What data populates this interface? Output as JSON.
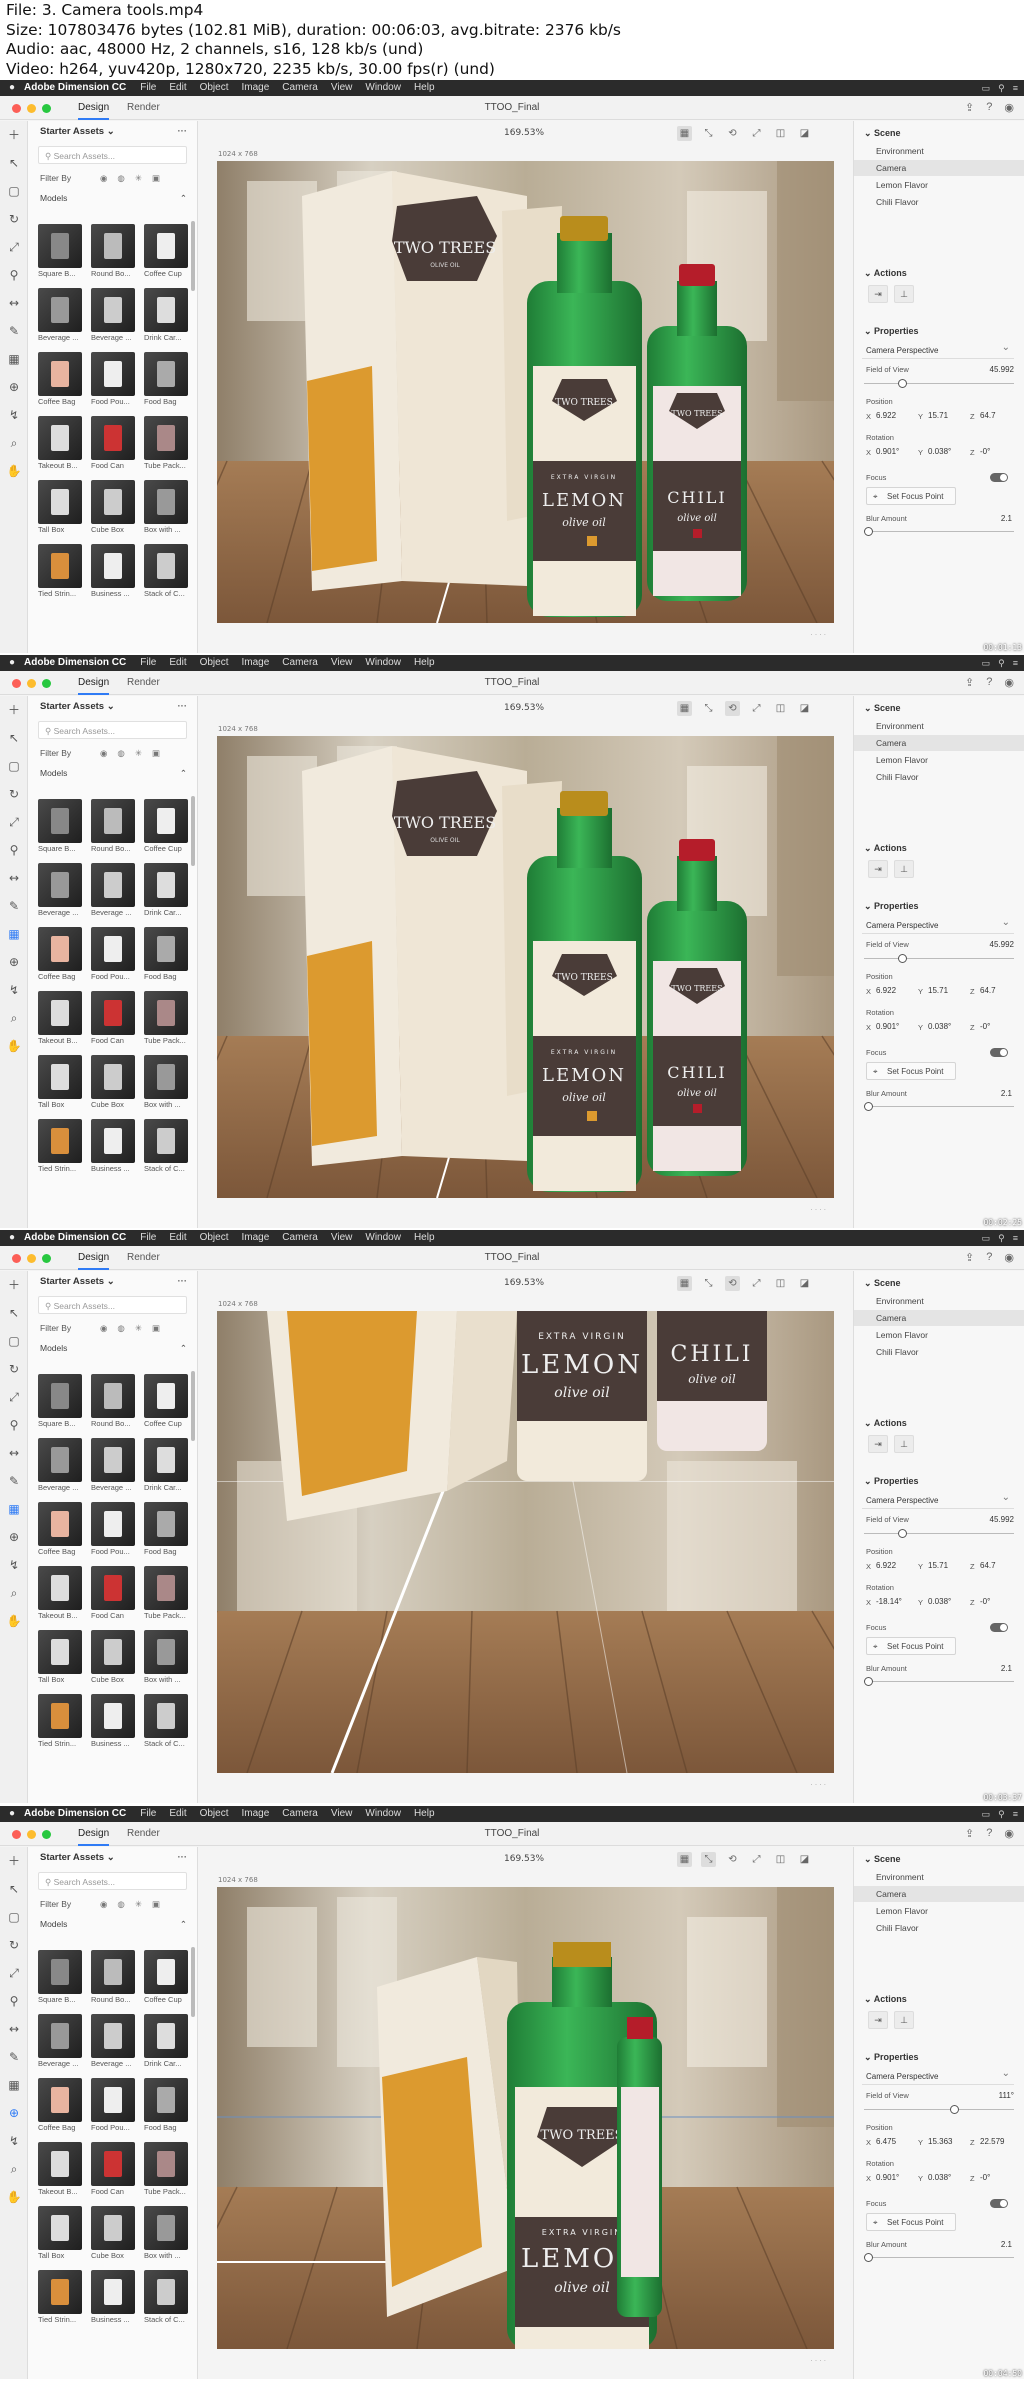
{
  "info_lines": [
    "File: 3. Camera tools.mp4",
    "Size: 107803476 bytes (102.81 MiB), duration: 00:06:03, avg.bitrate: 2376 kb/s",
    "Audio: aac, 48000 Hz, 2 channels, s16, 128 kb/s (und)",
    "Video: h264, yuv420p, 1280x720, 2235 kb/s, 30.00 fps(r) (und)"
  ],
  "menubar": {
    "app": "Adobe Dimension CC",
    "items": [
      "File",
      "Edit",
      "Object",
      "Image",
      "Camera",
      "View",
      "Window",
      "Help"
    ]
  },
  "tabs": {
    "design": "Design",
    "render": "Render"
  },
  "doc_title": "TTOO_Final",
  "assets": {
    "header": "Starter Assets",
    "search_placeholder": "Search Assets...",
    "filter_label": "Filter By",
    "models_label": "Models",
    "items": [
      "Square B...",
      "Round Bo...",
      "Coffee Cup",
      "Beverage ...",
      "Beverage ...",
      "Drink Car...",
      "Coffee Bag",
      "Food Pou...",
      "Food Bag",
      "Takeout B...",
      "Food Can",
      "Tube Pack...",
      "Tall Box",
      "Cube Box",
      "Box with ...",
      "Tied Strin...",
      "Business ...",
      "Stack of C..."
    ]
  },
  "viewport": {
    "dims": "1024 x 768"
  },
  "scene": {
    "title": "Scene",
    "items": [
      "Environment",
      "Camera",
      "Lemon Flavor",
      "Chili Flavor"
    ],
    "selected": "Camera"
  },
  "actions_title": "Actions",
  "properties": {
    "title": "Properties",
    "camera_type": "Camera Perspective",
    "fov_label": "Field of View",
    "position_label": "Position",
    "rotation_label": "Rotation",
    "focus_label": "Focus",
    "set_focus": "Set Focus Point",
    "blur_label": "Blur Amount",
    "blur_value": "2.1"
  },
  "product": {
    "brand": "TWO TREES",
    "sub": "OLIVE OIL",
    "extra": "EXTRA VIRGIN",
    "lemon": "LEMON",
    "chili": "CHILI",
    "oil": "olive oil"
  },
  "colors": {
    "accent": "#2f7bf5",
    "bottle": "#2fa24a",
    "cap_lemon": "#b98d1c",
    "cap_chili": "#b51d2a",
    "label_dark": "#4a3c38",
    "box_orange": "#dc9a2f"
  },
  "frames": [
    {
      "zoom": "169.53%",
      "fov": "45.992",
      "pos_x": "6.922",
      "pos_y": "15.71",
      "pos_z": "64.7",
      "rot_x": "0.901°",
      "rot_y": "0.038°",
      "rot_z": "-0°",
      "timestamp": "00:01:13",
      "active_cam_tool": 0,
      "view": "normal"
    },
    {
      "zoom": "169.53%",
      "fov": "45.992",
      "pos_x": "6.922",
      "pos_y": "15.71",
      "pos_z": "64.7",
      "rot_x": "0.901°",
      "rot_y": "0.038°",
      "rot_z": "-0°",
      "timestamp": "00:02:25",
      "active_cam_tool": 2,
      "view": "normal"
    },
    {
      "zoom": "169.53%",
      "fov": "45.992",
      "pos_x": "6.922",
      "pos_y": "15.71",
      "pos_z": "64.7",
      "rot_x": "-18.14°",
      "rot_y": "0.038°",
      "rot_z": "-0°",
      "timestamp": "00:03:37",
      "active_cam_tool": 2,
      "view": "tilted"
    },
    {
      "zoom": "169.53%",
      "fov": "111°",
      "pos_x": "6.475",
      "pos_y": "15.363",
      "pos_z": "22.579",
      "rot_x": "0.901°",
      "rot_y": "0.038°",
      "rot_z": "-0°",
      "timestamp": "00:04:50",
      "active_cam_tool": 1,
      "view": "zoomed"
    }
  ]
}
